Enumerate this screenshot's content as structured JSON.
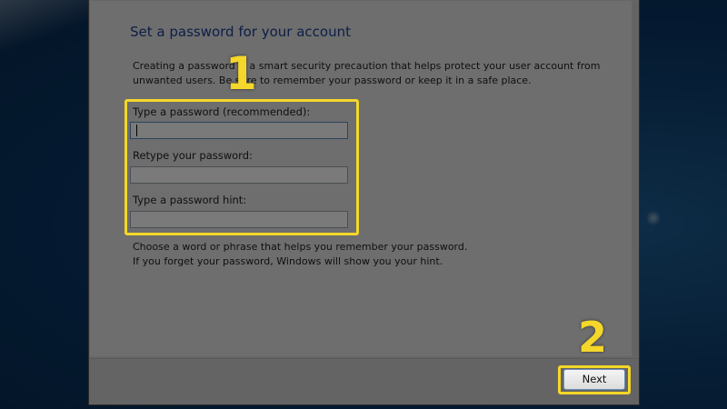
{
  "wizard": {
    "title": "Set a password for your account",
    "intro_lines": [
      "Creating a password is a smart security precaution that helps protect your user account from",
      "unwanted users. Be sure to remember your password or keep it in a safe place."
    ],
    "fields": [
      {
        "label": "Type a password (recommended):",
        "value": ""
      },
      {
        "label": "Retype your password:",
        "value": ""
      },
      {
        "label": "Type a password hint:",
        "value": ""
      }
    ],
    "hint_lines": [
      "Choose a word or phrase that helps you remember your password.",
      "If you forget your password, Windows will show you your hint."
    ],
    "next_label": "Next"
  },
  "annotations": {
    "step1": "1",
    "step2": "2",
    "color": "#f4d72a"
  },
  "colors": {
    "title": "#1c3f95",
    "desktop": "#0b3866"
  }
}
